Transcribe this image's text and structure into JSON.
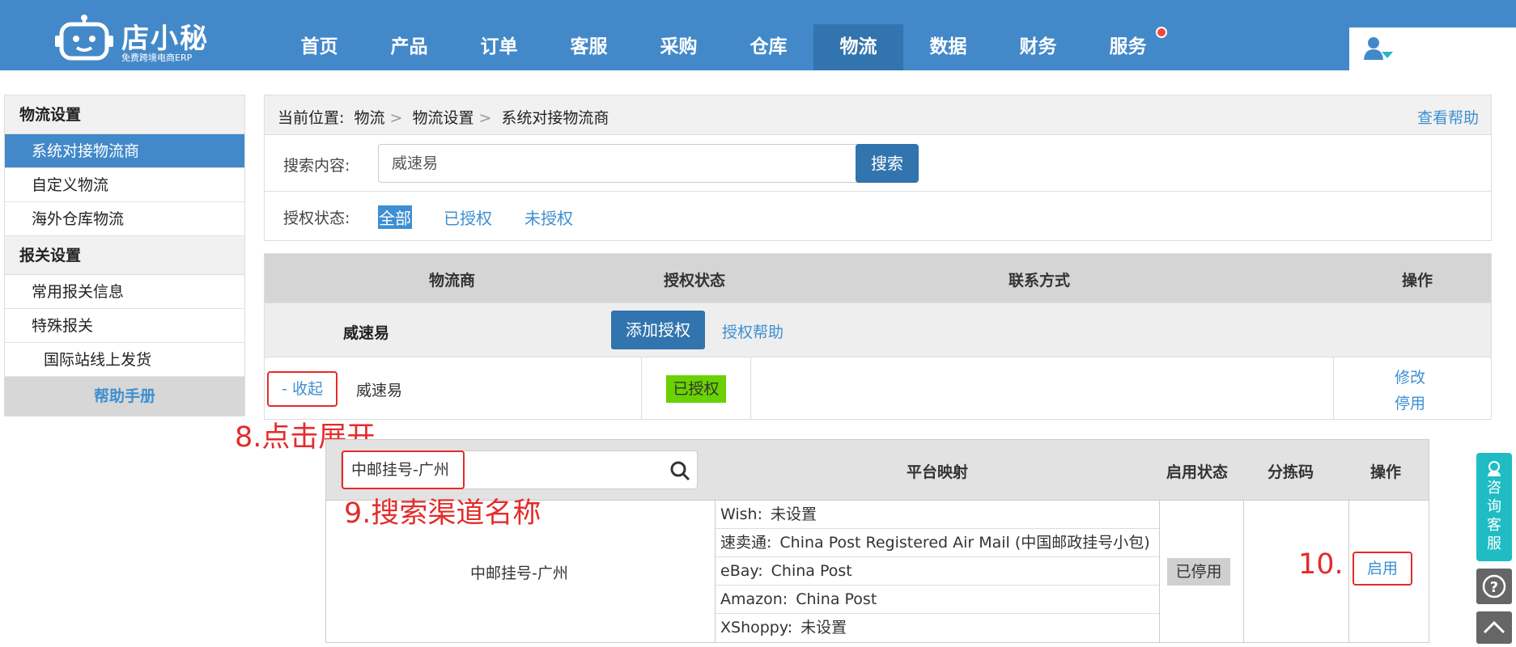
{
  "brand": {
    "name": "店小秘",
    "subtitle": "免费跨境电商ERP",
    "primary_color": "#4389c9",
    "active_color": "#3274ad"
  },
  "nav": {
    "items": [
      "首页",
      "产品",
      "订单",
      "客服",
      "采购",
      "仓库",
      "物流",
      "数据",
      "财务",
      "服务"
    ],
    "active": "物流"
  },
  "sidebar": {
    "group1": "物流设置",
    "items1": [
      "系统对接物流商",
      "自定义物流",
      "海外仓库物流"
    ],
    "group2": "报关设置",
    "items2": [
      "常用报关信息",
      "特殊报关",
      "国际站线上发货"
    ],
    "help": "帮助手册"
  },
  "breadcrumb": {
    "prefix": "当前位置:",
    "items": [
      "物流",
      "物流设置",
      "系统对接物流商"
    ],
    "help_link": "查看帮助"
  },
  "filter": {
    "search_label": "搜索内容:",
    "search_value": "威速易",
    "search_button": "搜索",
    "status_label": "授权状态:",
    "status_tabs": [
      "全部",
      "已授权",
      "未授权"
    ]
  },
  "table": {
    "headers": [
      "物流商",
      "授权状态",
      "联系方式",
      "操作"
    ],
    "group_name": "威速易",
    "add_auth": "添加授权",
    "auth_help": "授权帮助",
    "row": {
      "toggle": "- 收起",
      "name": "威速易",
      "status": "已授权",
      "edit": "修改",
      "disable": "停用"
    }
  },
  "annotations": {
    "step8": "8.点击展开",
    "step9": "9.搜索渠道名称",
    "step10": "10."
  },
  "channel": {
    "search_value": "中邮挂号-广州",
    "headers": [
      "平台映射",
      "启用状态",
      "分拣码",
      "操作"
    ],
    "name": "中邮挂号-广州",
    "mappings": [
      {
        "platform": "Wish:",
        "value": "未设置"
      },
      {
        "platform": "速卖通:",
        "value": "China Post Registered Air Mail (中国邮政挂号小包)"
      },
      {
        "platform": "eBay:",
        "value": "China Post"
      },
      {
        "platform": "Amazon:",
        "value": "China Post"
      },
      {
        "platform": "XShoppy:",
        "value": "未设置"
      }
    ],
    "status": "已停用",
    "enable": "启用"
  },
  "float": {
    "consult": "咨询客服"
  }
}
